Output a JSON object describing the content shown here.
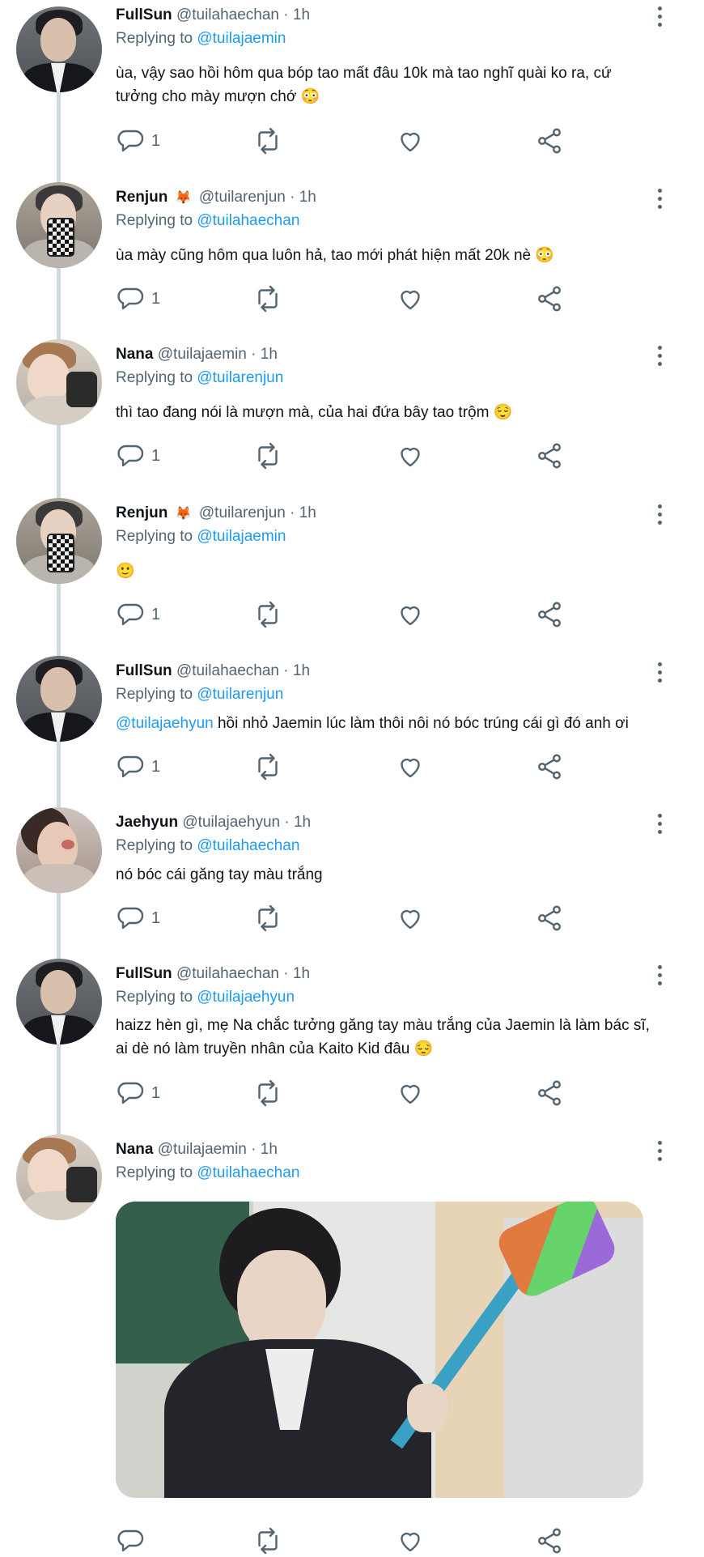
{
  "tweets": [
    {
      "name": "FullSun",
      "handle": "@tuilahaechan",
      "dot": "·",
      "time": "1h",
      "replying_label": "Replying to",
      "replying_to": "@tuilajaemin",
      "text_line1": "ùa, vậy sao hồi hôm qua bóp tao mất đâu 10k mà tao nghĩ quài ko ra, cứ",
      "text_line2": "tưởng cho mày mượn chớ 😳",
      "reply_count": "1"
    },
    {
      "name": "Renjun",
      "name_emoji": "🦊",
      "handle": "@tuilarenjun",
      "dot": "·",
      "time": "1h",
      "replying_label": "Replying to",
      "replying_to": "@tuilahaechan",
      "text_line1": "ùa mày cũng hôm qua luôn hả, tao mới phát hiện mất 20k nè 😳",
      "reply_count": "1"
    },
    {
      "name": "Nana",
      "handle": "@tuilajaemin",
      "dot": "·",
      "time": "1h",
      "replying_label": "Replying to",
      "replying_to": "@tuilarenjun",
      "text_line1": "thì tao đang nói là mượn mà, của hai đứa bây tao trộm 😌",
      "reply_count": "1"
    },
    {
      "name": "Renjun",
      "name_emoji": "🦊",
      "handle": "@tuilarenjun",
      "dot": "·",
      "time": "1h",
      "replying_label": "Replying to",
      "replying_to": "@tuilajaemin",
      "text_line1": "🙂",
      "reply_count": "1"
    },
    {
      "name": "FullSun",
      "handle": "@tuilahaechan",
      "dot": "·",
      "time": "1h",
      "replying_label": "Replying to",
      "replying_to": "@tuilarenjun",
      "mention": "@tuilajaehyun",
      "text_line1": " hồi nhỏ Jaemin lúc làm thôi nôi nó bóc trúng cái gì đó anh ơi",
      "reply_count": "1"
    },
    {
      "name": "Jaehyun",
      "handle": "@tuilajaehyun",
      "dot": "·",
      "time": "1h",
      "replying_label": "Replying to",
      "replying_to": "@tuilahaechan",
      "text_line1": "nó bóc cái găng tay màu trắng",
      "reply_count": "1"
    },
    {
      "name": "FullSun",
      "handle": "@tuilahaechan",
      "dot": "·",
      "time": "1h",
      "replying_label": "Replying to",
      "replying_to": "@tuilajaehyun",
      "text_line1": "haizz hèn gì, mẹ Na chắc tưởng găng tay màu trắng của Jaemin là làm bác sĩ,",
      "text_line2": "ai dè nó làm truyền nhân của Kaito Kid đâu 😔",
      "reply_count": "1"
    },
    {
      "name": "Nana",
      "handle": "@tuilajaemin",
      "dot": "·",
      "time": "1h",
      "replying_label": "Replying to",
      "replying_to": "@tuilahaechan",
      "reply_count": ""
    }
  ],
  "icons": {
    "reply": "reply-icon",
    "retweet": "retweet-icon",
    "like": "heart-icon",
    "share": "share-icon",
    "more": "more-options-icon"
  },
  "colors": {
    "link": "#1d9bf0",
    "secondary_text": "#536471",
    "primary_text": "#0f1419",
    "thread_line": "#cfd9de"
  }
}
